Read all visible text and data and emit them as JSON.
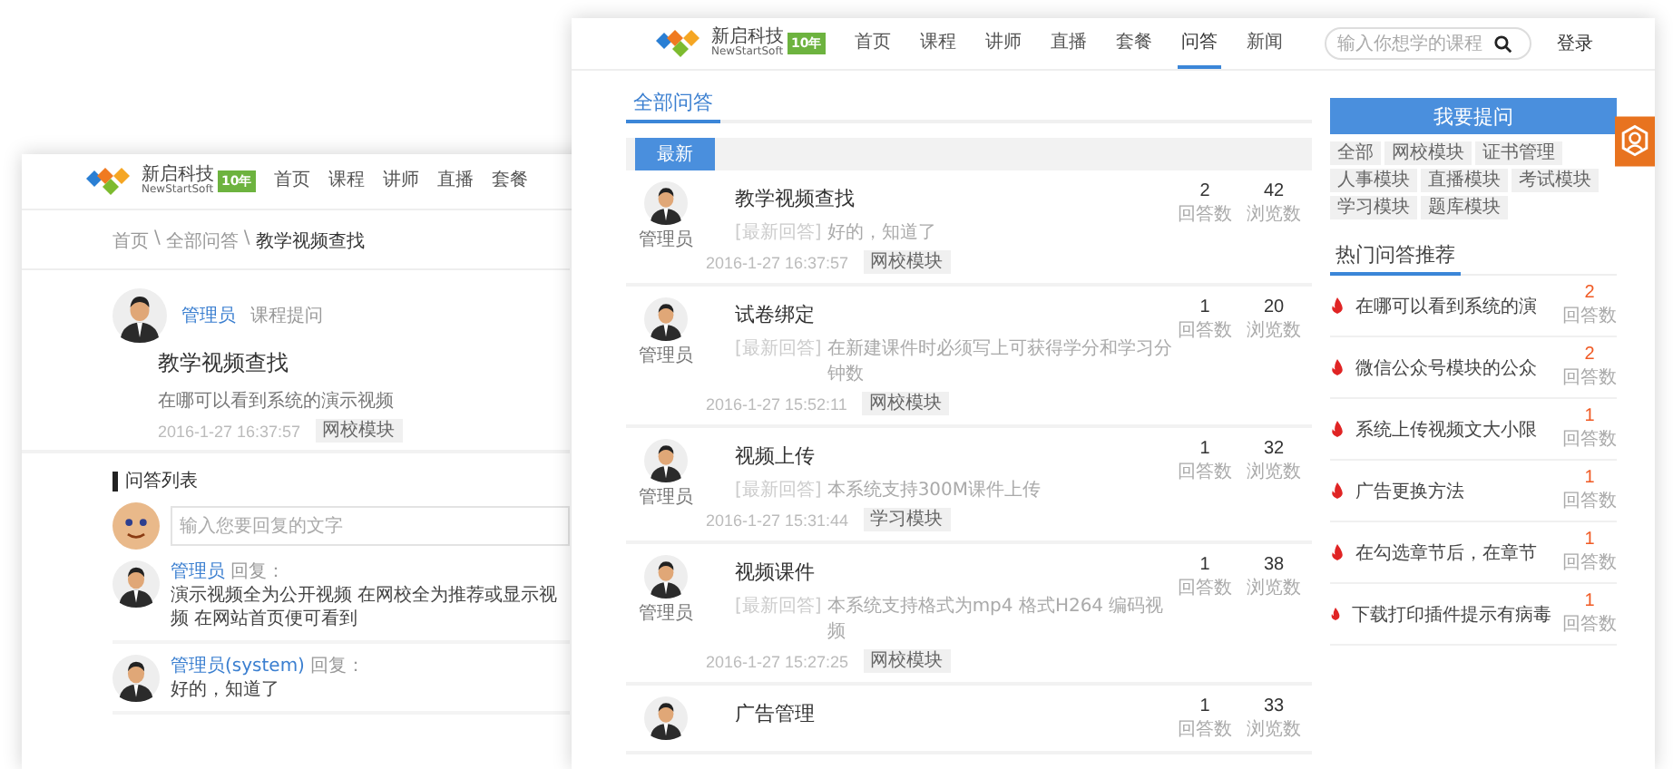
{
  "detail_window": {
    "header": {
      "logo": {
        "name": "新启科技",
        "sub": "NewStartSoft",
        "badge": "10年"
      },
      "nav": [
        "首页",
        "课程",
        "讲师",
        "直播",
        "套餐"
      ]
    },
    "breadcrumb": {
      "separator": "\\",
      "items": [
        "首页",
        "全部问答",
        "教学视频查找"
      ]
    },
    "question": {
      "author": "管理员",
      "category": "课程提问",
      "title": "教学视频查找",
      "body": "在哪可以看到系统的演示视频",
      "time": "2016-1-27 16:37:57",
      "tag": "网校模块"
    },
    "answers_title": "问答列表",
    "reply_input": {
      "placeholder": "输入您要回复的文字"
    },
    "replies": [
      {
        "author": "管理员",
        "verb": "回复：",
        "text": "演示视频全为公开视频 在网校全为推荐或显示视频 在网站首页便可看到"
      },
      {
        "author": "管理员(system)",
        "verb": "回复：",
        "text": "好的，知道了"
      }
    ]
  },
  "list_window": {
    "header": {
      "logo": {
        "name": "新启科技",
        "sub": "NewStartSoft",
        "badge": "10年"
      },
      "nav": [
        {
          "label": "首页",
          "selected": false
        },
        {
          "label": "课程",
          "selected": false
        },
        {
          "label": "讲师",
          "selected": false
        },
        {
          "label": "直播",
          "selected": false
        },
        {
          "label": "套餐",
          "selected": false
        },
        {
          "label": "问答",
          "selected": true
        },
        {
          "label": "新闻",
          "selected": false
        }
      ],
      "search": {
        "placeholder": "输入你想学的课程"
      },
      "login": "登录"
    },
    "section_tab": "全部问答",
    "filter_tabs": [
      {
        "label": "最新",
        "selected": true
      }
    ],
    "questions": [
      {
        "author": "管理员",
        "title": "教学视频查找",
        "excerpt_label": "[最新回答]",
        "excerpt": "好的，知道了",
        "time": "2016-1-27 16:37:57",
        "tag": "网校模块",
        "answers": "2",
        "answers_label": "回答数",
        "views": "42",
        "views_label": "浏览数"
      },
      {
        "author": "管理员",
        "title": "试卷绑定",
        "excerpt_label": "[最新回答]",
        "excerpt": "在新建课件时必须写上可获得学分和学习分钟数",
        "time": "2016-1-27 15:52:11",
        "tag": "网校模块",
        "answers": "1",
        "answers_label": "回答数",
        "views": "20",
        "views_label": "浏览数"
      },
      {
        "author": "管理员",
        "title": "视频上传",
        "excerpt_label": "[最新回答]",
        "excerpt": "本系统支持300M课件上传",
        "time": "2016-1-27 15:31:44",
        "tag": "学习模块",
        "answers": "1",
        "answers_label": "回答数",
        "views": "32",
        "views_label": "浏览数"
      },
      {
        "author": "管理员",
        "title": "视频课件",
        "excerpt_label": "[最新回答]",
        "excerpt": "本系统支持格式为mp4 格式H264 编码视频",
        "time": "2016-1-27 15:27:25",
        "tag": "网校模块",
        "answers": "1",
        "answers_label": "回答数",
        "views": "38",
        "views_label": "浏览数"
      },
      {
        "title": "广告管理",
        "answers": "1",
        "answers_label": "回答数",
        "views": "33",
        "views_label": "浏览数"
      }
    ],
    "sidebar": {
      "ask_button": "我要提问",
      "tags": [
        "全部",
        "网校模块",
        "证书管理",
        "人事模块",
        "直播模块",
        "考试模块",
        "学习模块",
        "题库模块"
      ],
      "hot_title": "热门问答推荐",
      "hot": [
        {
          "title": "在哪可以看到系统的演",
          "count": "2",
          "count_label": "回答数"
        },
        {
          "title": "微信公众号模块的公众",
          "count": "2",
          "count_label": "回答数"
        },
        {
          "title": "系统上传视频文大小限",
          "count": "1",
          "count_label": "回答数"
        },
        {
          "title": "广告更换方法",
          "count": "1",
          "count_label": "回答数"
        },
        {
          "title": "在勾选章节后，在章节",
          "count": "1",
          "count_label": "回答数"
        },
        {
          "title": "下载打印插件提示有病毒",
          "count": "1",
          "count_label": "回答数"
        }
      ]
    }
  }
}
